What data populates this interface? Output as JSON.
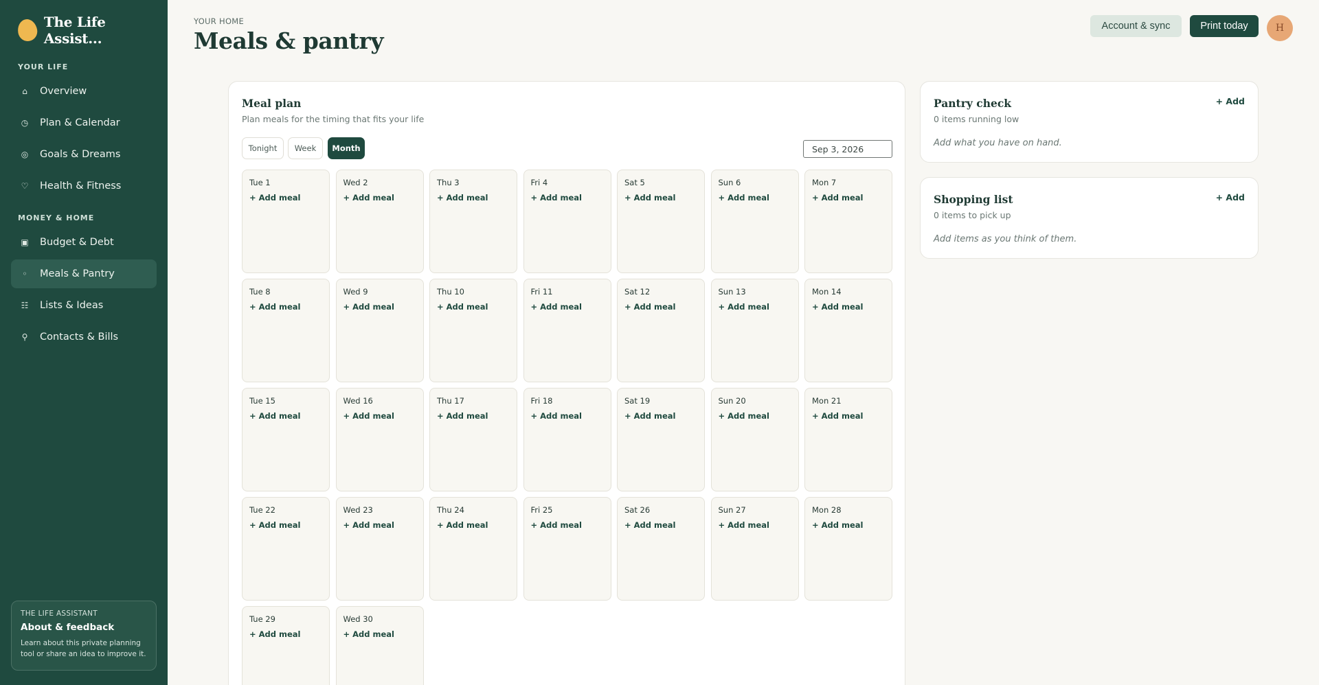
{
  "app": {
    "name": "The Life Assist..."
  },
  "sidebar": {
    "sections": [
      {
        "label": "YOUR LIFE",
        "items": [
          {
            "label": "Overview",
            "icon": "home-icon",
            "glyph": "⌂"
          },
          {
            "label": "Plan & Calendar",
            "icon": "clock-icon",
            "glyph": "◷"
          },
          {
            "label": "Goals & Dreams",
            "icon": "target-icon",
            "glyph": "◎"
          },
          {
            "label": "Health & Fitness",
            "icon": "heart-icon",
            "glyph": "♡"
          }
        ]
      },
      {
        "label": "MONEY & HOME",
        "items": [
          {
            "label": "Budget & Debt",
            "icon": "wallet-icon",
            "glyph": "▣"
          },
          {
            "label": "Meals & Pantry",
            "icon": "bowl-icon",
            "glyph": "◦",
            "active": true
          },
          {
            "label": "Lists & Ideas",
            "icon": "list-icon",
            "glyph": "☷"
          },
          {
            "label": "Contacts & Bills",
            "icon": "pin-icon",
            "glyph": "⚲"
          }
        ]
      }
    ],
    "about": {
      "eyebrow": "THE LIFE ASSISTANT",
      "title": "About & feedback",
      "description": "Learn about this private planning tool or share an idea to improve it."
    }
  },
  "header": {
    "eyebrow": "YOUR HOME",
    "title": "Meals & pantry",
    "account_label": "Account & sync",
    "print_label": "Print today",
    "avatar_initial": "H"
  },
  "meal_plan": {
    "title": "Meal plan",
    "subtitle": "Plan meals for the timing that fits your life",
    "views": [
      {
        "label": "Tonight",
        "active": false
      },
      {
        "label": "Week",
        "active": false
      },
      {
        "label": "Month",
        "active": true
      }
    ],
    "date_value": "Sep 3, 2026",
    "add_label": "+ Add meal",
    "days": [
      "Tue 1",
      "Wed 2",
      "Thu 3",
      "Fri 4",
      "Sat 5",
      "Sun 6",
      "Mon 7",
      "Tue 8",
      "Wed 9",
      "Thu 10",
      "Fri 11",
      "Sat 12",
      "Sun 13",
      "Mon 14",
      "Tue 15",
      "Wed 16",
      "Thu 17",
      "Fri 18",
      "Sat 19",
      "Sun 20",
      "Mon 21",
      "Tue 22",
      "Wed 23",
      "Thu 24",
      "Fri 25",
      "Sat 26",
      "Sun 27",
      "Mon 28",
      "Tue 29",
      "Wed 30"
    ]
  },
  "pantry": {
    "title": "Pantry check",
    "subtitle": "0 items running low",
    "add_label": "+ Add",
    "empty": "Add what you have on hand."
  },
  "shopping": {
    "title": "Shopping list",
    "subtitle": "0 items to pick up",
    "add_label": "+ Add",
    "empty": "Add items as you think of them."
  },
  "colors": {
    "sidebar": "#1f4a3f",
    "accent": "#1f4a3f",
    "background": "#f8f7f3",
    "brand_mark": "#efb850",
    "avatar": "#e7a775"
  }
}
